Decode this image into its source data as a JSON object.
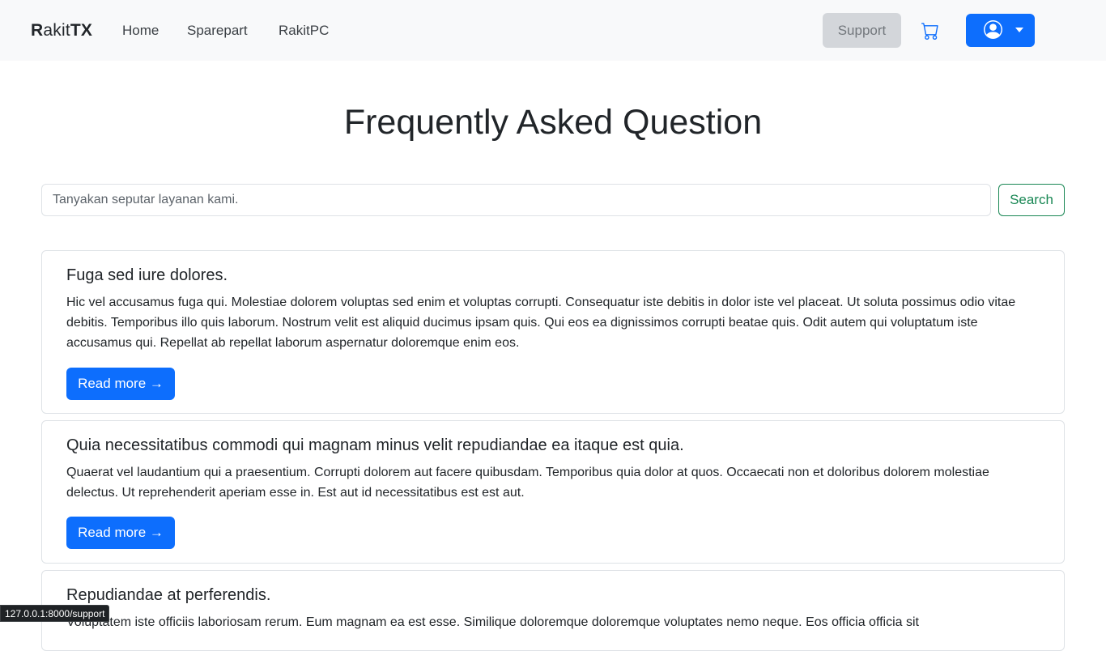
{
  "navbar": {
    "brand_part1": "R",
    "brand_part2": "akit",
    "brand_part3": "TX",
    "links": [
      "Home",
      "Sparepart",
      "RakitPC"
    ],
    "support_label": "Support",
    "cart_icon": "cart-icon",
    "user_icon": "user-circle-icon",
    "dropdown_icon": "caret-down-icon"
  },
  "page": {
    "title": "Frequently Asked Question"
  },
  "search": {
    "placeholder": "Tanyakan seputar layanan kami.",
    "value": "",
    "button_label": "Search"
  },
  "faq": [
    {
      "title": "Fuga sed iure dolores.",
      "text": "Hic vel accusamus fuga qui. Molestiae dolorem voluptas sed enim et voluptas corrupti. Consequatur iste debitis in dolor iste vel placeat. Ut soluta possimus odio vitae debitis. Temporibus illo quis laborum. Nostrum velit est aliquid ducimus ipsam quis. Qui eos ea dignissimos corrupti beatae quis. Odit autem qui voluptatum iste accusamus qui. Repellat ab repellat laborum aspernatur doloremque enim eos.",
      "button": "Read more →"
    },
    {
      "title": "Quia necessitatibus commodi qui magnam minus velit repudiandae ea itaque est quia.",
      "text": "Quaerat vel laudantium qui a praesentium. Corrupti dolorem aut facere quibusdam. Temporibus quia dolor at quos. Occaecati non et doloribus dolorem molestiae delectus. Ut reprehenderit aperiam esse in. Est aut id necessitatibus est est aut.",
      "button": "Read more →"
    },
    {
      "title": "Repudiandae at perferendis.",
      "text": "Voluptatem iste officiis laboriosam rerum. Eum magnam ea est esse. Similique doloremque doloremque voluptates nemo neque. Eos officia officia sit"
    }
  ],
  "status_bar": {
    "url": "127.0.0.1:8000/support"
  },
  "colors": {
    "primary": "#0d6efd",
    "success": "#198754",
    "navbar_bg": "#f8f9fa",
    "support_bg": "#d3d6da"
  }
}
